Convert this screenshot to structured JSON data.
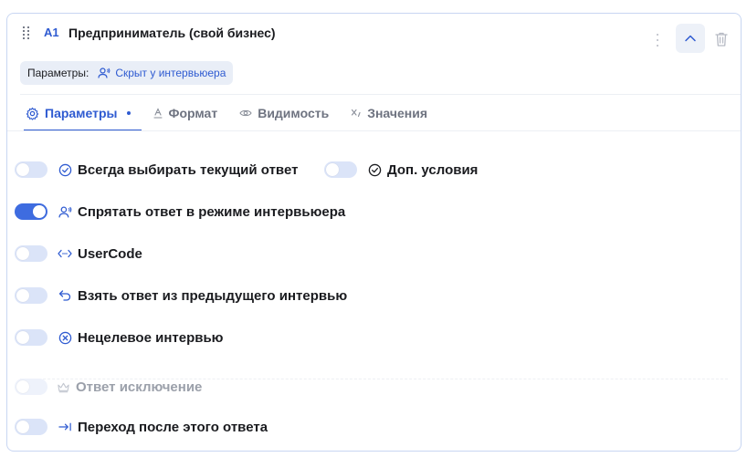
{
  "question": {
    "code": "A1",
    "title": "Предприниматель (свой бизнес)"
  },
  "params_badge": {
    "label": "Параметры:",
    "value": "Скрыт у интервьюера"
  },
  "tabs": [
    {
      "label": "Параметры",
      "icon": "gear-icon",
      "active": true
    },
    {
      "label": "Формат",
      "icon": "format-icon",
      "active": false
    },
    {
      "label": "Видимость",
      "icon": "eye-icon",
      "active": false
    },
    {
      "label": "Значения",
      "icon": "variable-icon",
      "active": false
    }
  ],
  "options": {
    "always_select": {
      "label": "Всегда выбирать текущий ответ",
      "on": false
    },
    "extra_conditions": {
      "label": "Доп. условия",
      "on": false
    },
    "hide_answer": {
      "label": "Спрятать ответ в режиме интервьюера",
      "on": true
    },
    "usercode": {
      "label": "UserCode",
      "on": false
    },
    "take_prev": {
      "label": "Взять ответ из предыдущего интервью",
      "on": false
    },
    "non_target": {
      "label": "Нецелевое интервью",
      "on": false
    },
    "exclusion": {
      "label": "Ответ исключение",
      "on": false,
      "disabled": true
    },
    "jump_after": {
      "label": "Переход после этого ответа",
      "on": false
    }
  },
  "colors": {
    "accent": "#2f5bd1",
    "toggle_on": "#3e6ce0",
    "toggle_off": "#dbe4f8"
  }
}
